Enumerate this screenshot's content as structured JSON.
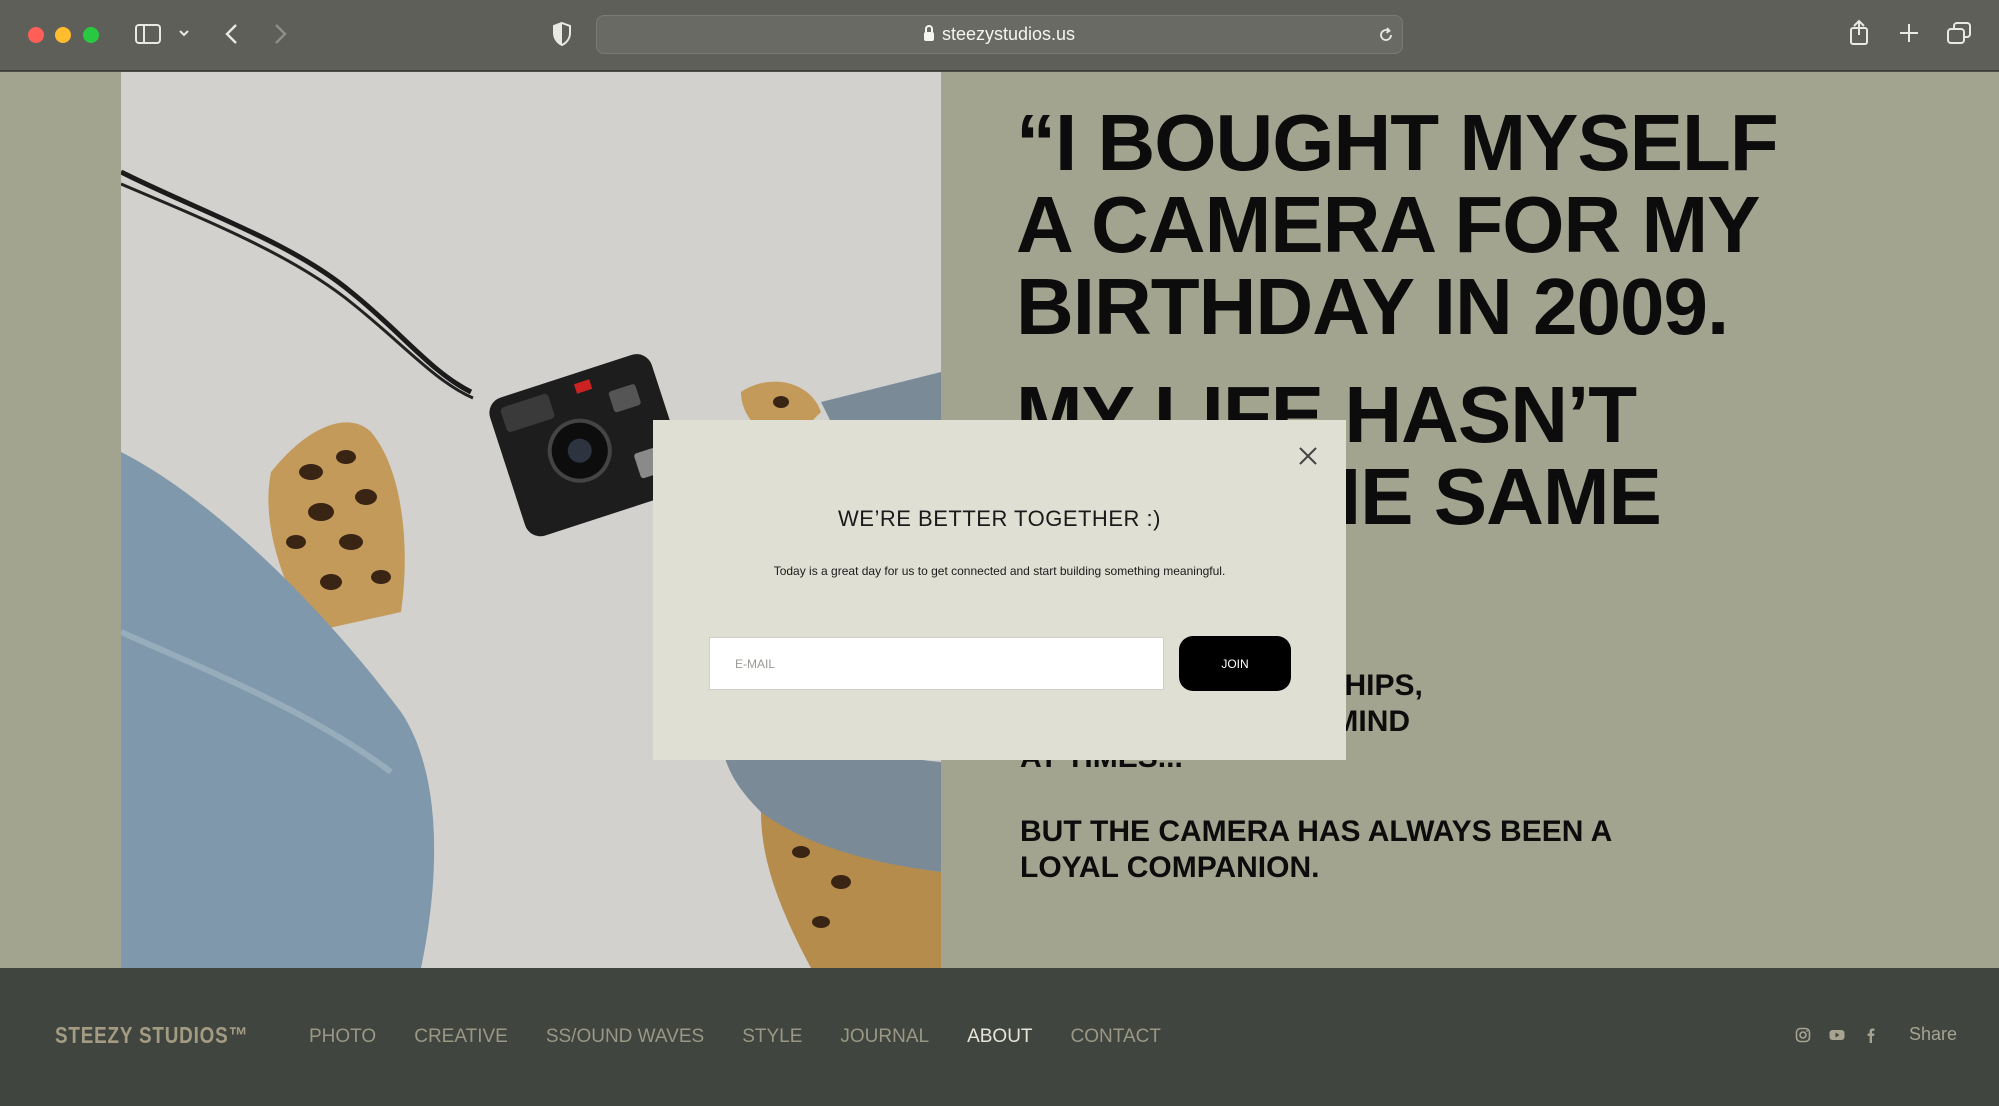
{
  "browser": {
    "url": "steezystudios.us",
    "icons": [
      "sidebar-icon",
      "chevron-down-icon",
      "back-icon",
      "forward-icon",
      "shield-icon",
      "lock-icon",
      "reload-icon",
      "share-icon",
      "new-tab-icon",
      "tabs-overview-icon"
    ]
  },
  "quote": {
    "line1": "“I BOUGHT MYSELF",
    "line2": " A CAMERA FOR MY",
    "line3": "BIRTHDAY IN 2009.",
    "line4": "MY LIFE HASN’T",
    "line5": "BEEN THE SAME",
    "small1": "I’VE LOST RELATIONSHIPS,",
    "small2": "JOBS, AND EVEN MY MIND",
    "small3": "AT TIMES...",
    "small4": "BUT THE CAMERA HAS ALWAYS BEEN A",
    "small5": "LOYAL COMPANION."
  },
  "footer": {
    "brand": "STEEZY STUDIOS™",
    "nav": [
      "PHOTO",
      "CREATIVE",
      "SS/OUND WAVES",
      "STYLE",
      "JOURNAL",
      "ABOUT",
      "CONTACT"
    ],
    "active": "ABOUT",
    "share_label": "Share",
    "social_icons": [
      "instagram-icon",
      "youtube-icon",
      "facebook-icon"
    ]
  },
  "modal": {
    "title": "WE’RE BETTER TOGETHER :)",
    "subtitle": "Today is a great day for us to get connected and start building something meaningful.",
    "email_placeholder": "E-MAIL",
    "join_label": "JOIN"
  },
  "colors": {
    "page_bg": "#a3a490",
    "footer_bg": "#414540",
    "modal_bg": "#e0dfd4",
    "accent": "#000000"
  }
}
